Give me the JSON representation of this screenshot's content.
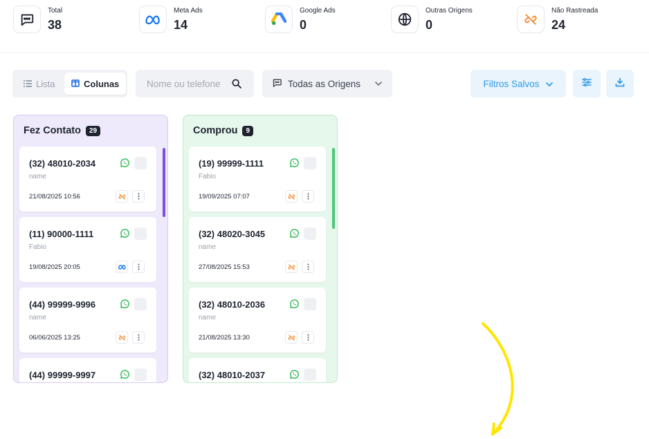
{
  "stats": [
    {
      "label": "Total",
      "value": "38",
      "icon": "chat-bubble-icon"
    },
    {
      "label": "Meta Ads",
      "value": "14",
      "icon": "meta-logo-icon"
    },
    {
      "label": "Google Ads",
      "value": "0",
      "icon": "google-ads-logo-icon"
    },
    {
      "label": "Outras Origens",
      "value": "0",
      "icon": "globe-icon"
    },
    {
      "label": "Não Rastreada",
      "value": "24",
      "icon": "broken-link-icon"
    }
  ],
  "toolbar": {
    "view_lista": "Lista",
    "view_colunas": "Colunas",
    "search_placeholder": "Nome ou telefone",
    "origin_selected": "Todas as Origens",
    "saved_filters": "Filtros Salvos"
  },
  "colors": {
    "purple_accent": "#7c4fe0",
    "green_accent": "#4cc67a",
    "whatsapp": "#25b84c",
    "untracked": "#f08a2e",
    "meta": "#1877f2",
    "primary_blue": "#2f9be6",
    "annotation_arrow": "#ffe600"
  },
  "columns": [
    {
      "title": "Fez Contato",
      "count": "29",
      "cards": [
        {
          "phone": "(32) 48010-2034",
          "name": "name",
          "date": "21/08/2025 10:56",
          "source": "broken-link-icon"
        },
        {
          "phone": "(11) 90000-1111",
          "name": "Fabio",
          "date": "19/08/2025 20:05",
          "source": "meta-logo-icon"
        },
        {
          "phone": "(44) 99999-9996",
          "name": "name",
          "date": "06/06/2025 13:25",
          "source": "broken-link-icon"
        },
        {
          "phone": "(44) 99999-9997",
          "name": "",
          "date": "",
          "source": ""
        }
      ]
    },
    {
      "title": "Comprou",
      "count": "9",
      "cards": [
        {
          "phone": "(19) 99999-1111",
          "name": "Fabio",
          "date": "19/09/2025 07:07",
          "source": "broken-link-icon"
        },
        {
          "phone": "(32) 48020-3045",
          "name": "name",
          "date": "27/08/2025 15:53",
          "source": "broken-link-icon"
        },
        {
          "phone": "(32) 48010-2036",
          "name": "name",
          "date": "21/08/2025 13:30",
          "source": "broken-link-icon"
        },
        {
          "phone": "(32) 48010-2037",
          "name": "",
          "date": "",
          "source": ""
        }
      ]
    }
  ]
}
